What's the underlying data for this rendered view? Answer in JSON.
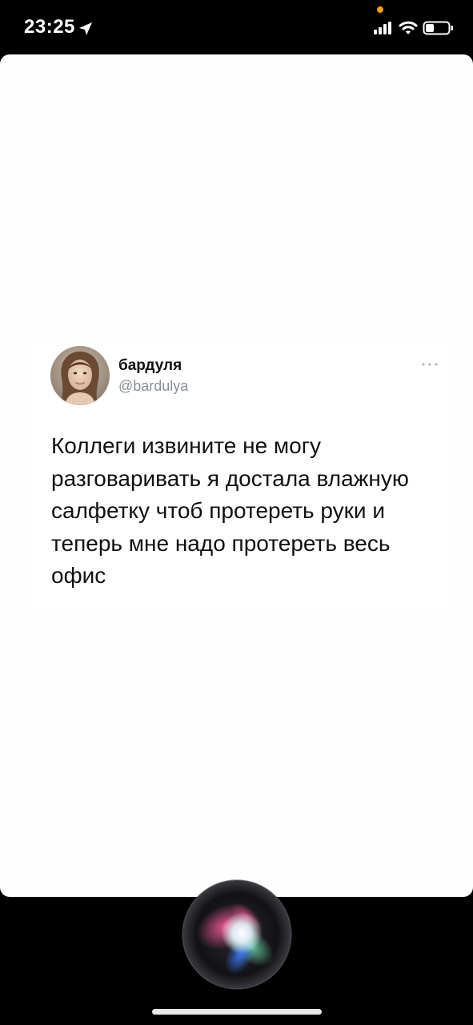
{
  "status_bar": {
    "time": "23:25",
    "icons": [
      "location-arrow-icon",
      "privacy-dot-icon",
      "cellular-signal-icon",
      "wifi-icon",
      "battery-icon"
    ],
    "privacy_dot_color": "#ff9f0a"
  },
  "tweet": {
    "display_name": "бардуля",
    "handle": "@bardulya",
    "text": "Коллеги извините не могу разговаривать я достала влажную салфетку чтоб протереть руки и теперь мне надо протереть весь офис",
    "more_icon": "ellipsis-icon",
    "avatar": "avatar-photo",
    "handle_color": "#8a9098"
  },
  "siri": {
    "icon": "siri-orb-icon"
  }
}
